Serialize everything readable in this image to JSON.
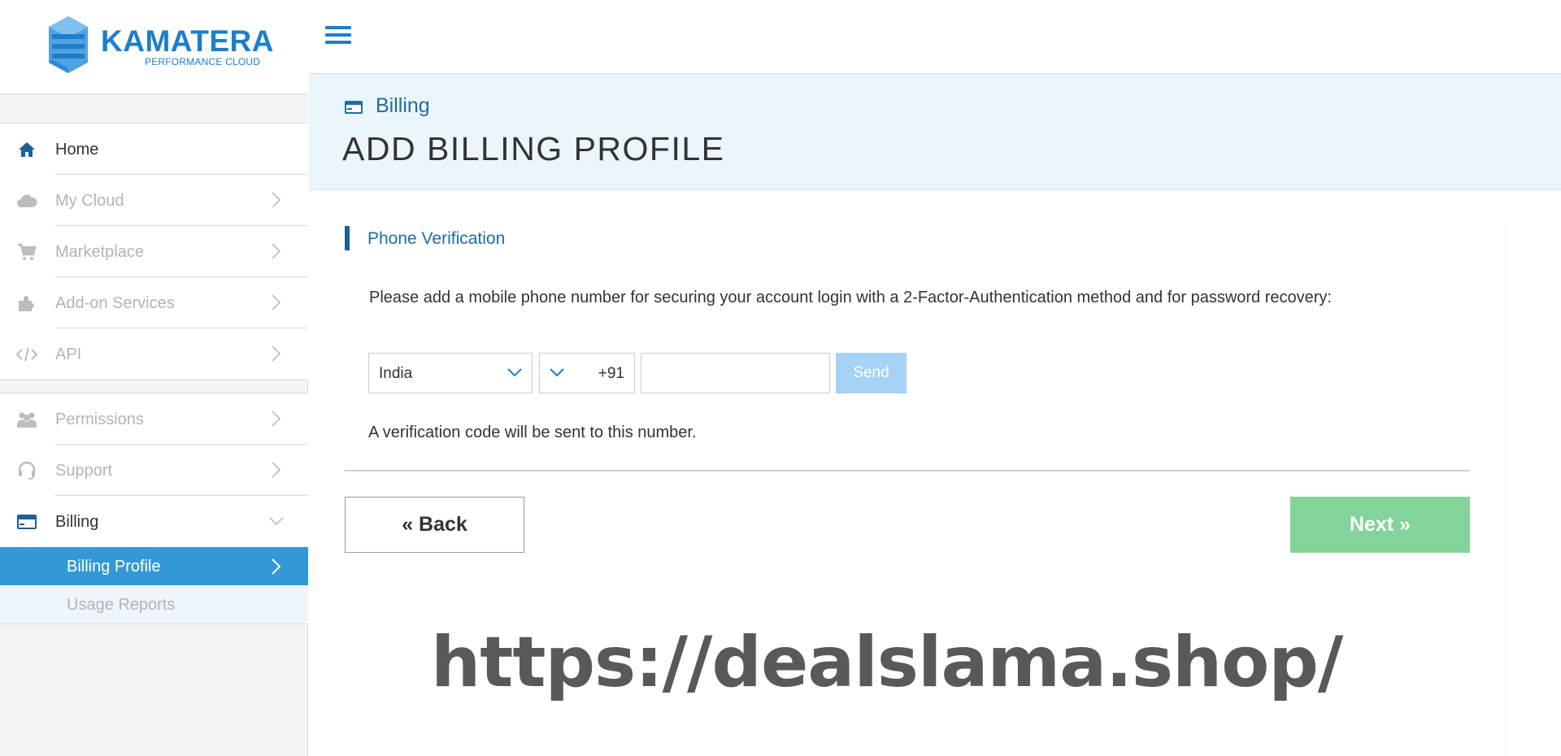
{
  "brand": {
    "name": "KAMATERA",
    "tagline": "PERFORMANCE CLOUD",
    "color": "#1d7fcb"
  },
  "sidebar": {
    "items": [
      {
        "label": "Home",
        "icon": "home-icon",
        "active": true,
        "has_chevron": false
      },
      {
        "label": "My Cloud",
        "icon": "cloud-icon",
        "active": false,
        "has_chevron": true
      },
      {
        "label": "Marketplace",
        "icon": "cart-icon",
        "active": false,
        "has_chevron": true
      },
      {
        "label": "Add-on Services",
        "icon": "puzzle-icon",
        "active": false,
        "has_chevron": true
      },
      {
        "label": "API",
        "icon": "code-icon",
        "active": false,
        "has_chevron": true
      },
      {
        "label": "Permissions",
        "icon": "users-icon",
        "active": false,
        "has_chevron": true
      },
      {
        "label": "Support",
        "icon": "headset-icon",
        "active": false,
        "has_chevron": true
      },
      {
        "label": "Billing",
        "icon": "credit-card-icon",
        "active": true,
        "has_chevron": true,
        "expanded": true
      }
    ],
    "sub_items": [
      {
        "label": "Billing Profile",
        "selected": true
      },
      {
        "label": "Usage Reports",
        "selected": false
      }
    ],
    "selected_color": "#3399d6"
  },
  "header": {
    "breadcrumb": "Billing",
    "title": "ADD BILLING PROFILE"
  },
  "form": {
    "section_title": "Phone Verification",
    "description": "Please add a mobile phone number for securing your account login with a 2-Factor-Authentication method and for password recovery:",
    "country": "India",
    "dial_code": "+91",
    "phone_value": "",
    "send_label": "Send",
    "hint": "A verification code will be sent to this number."
  },
  "actions": {
    "back_label": "« Back",
    "next_label": "Next »",
    "next_color": "#82d49a"
  },
  "watermark": "https://dealslama.shop/"
}
